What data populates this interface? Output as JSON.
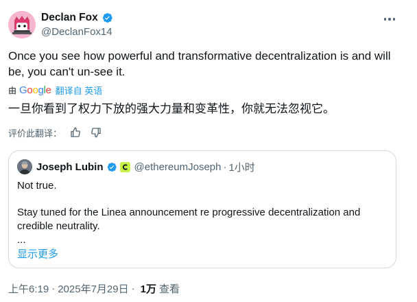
{
  "author": {
    "display_name": "Declan Fox",
    "handle": "@DeclanFox14"
  },
  "tweet": {
    "text": "Once you see how powerful and transformative decentralization is and will be, you can't un-see it.",
    "translated_text": "一旦你看到了权力下放的强大力量和变革性，你就无法忽视它。"
  },
  "translation": {
    "by_label": "由",
    "provider_letters": [
      "G",
      "o",
      "o",
      "g",
      "l",
      "e"
    ],
    "link_label": "翻译自 英语",
    "rate_label": "评价此翻译："
  },
  "quote": {
    "display_name": "Joseph Lubin",
    "handle": "@ethereumJoseph",
    "dot": "·",
    "time": "1小时",
    "lines": [
      "Not true.",
      "Stay tuned for the Linea announcement re progressive decentralization and",
      "credible neutrality.",
      "..."
    ],
    "show_more": "显示更多"
  },
  "meta": {
    "time": "上午6:19",
    "sep": "·",
    "date": "2025年7月29日",
    "views_count": "1万",
    "views_label": "查看"
  },
  "colors": {
    "accent": "#1d9bf0",
    "text_primary": "#0f1419",
    "text_secondary": "#536471",
    "border": "#cfd9de",
    "avatar_bg": "#f7b6cf",
    "badge_bg": "#c6f246"
  },
  "icons": [
    "verified-badge-icon",
    "more-icon",
    "thumbs-up-icon",
    "thumbs-down-icon",
    "avatar-image",
    "community-badge-icon"
  ]
}
